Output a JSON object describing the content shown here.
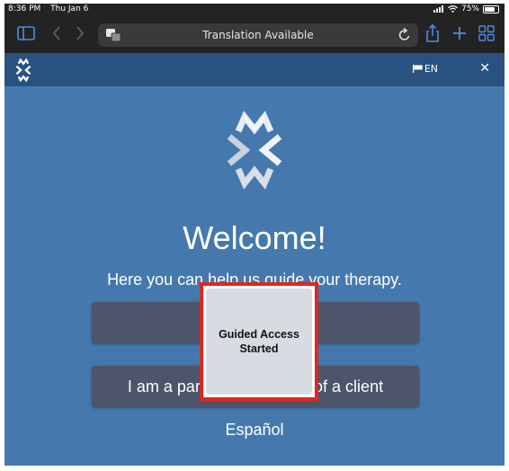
{
  "status_bar": {
    "time": "8:36 PM",
    "date": "Thu Jan 6",
    "battery": "75%",
    "battery_level": 0.75
  },
  "browser": {
    "address_text": "Translation Available"
  },
  "app_header": {
    "language": "EN"
  },
  "main": {
    "welcome": "Welcome!",
    "subtitle": "Here you can help us guide your therapy.",
    "button_parent": "I am a parent or guardian of a client",
    "language_link": "Español"
  },
  "overlay": {
    "line1": "Guided Access",
    "line2": "Started"
  },
  "colors": {
    "page_bg": "#4579ae",
    "header_bg": "#2a5281",
    "button_bg": "#4e5469",
    "overlay_border": "#e0271e"
  }
}
